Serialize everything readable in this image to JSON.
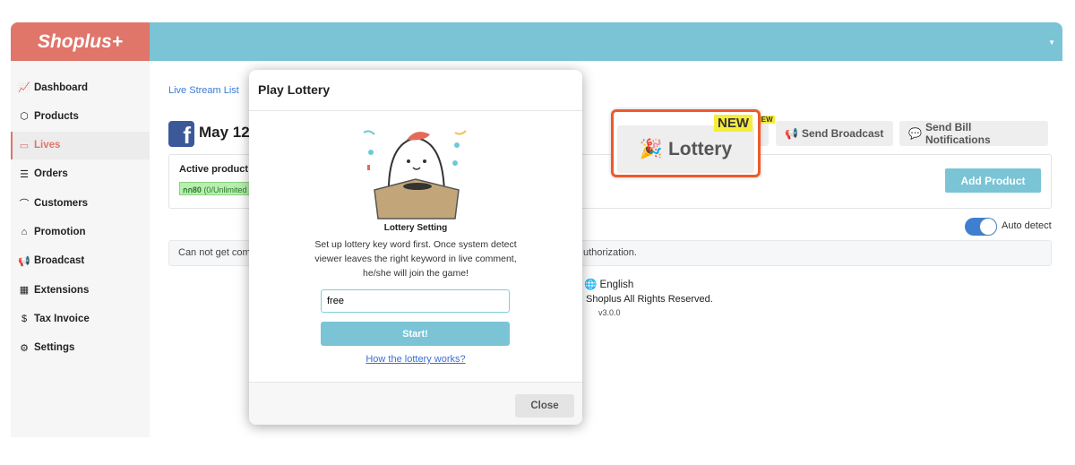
{
  "header": {
    "logo": "Shoplus+",
    "menu_icon": "caret-down-icon"
  },
  "sidebar": {
    "items": [
      {
        "label": "Dashboard",
        "icon": "chart-line-icon",
        "glyph": "📈"
      },
      {
        "label": "Products",
        "icon": "box-icon",
        "glyph": "⬡"
      },
      {
        "label": "Lives",
        "icon": "live-icon",
        "glyph": "▭",
        "active": true
      },
      {
        "label": "Orders",
        "icon": "list-icon",
        "glyph": "☰"
      },
      {
        "label": "Customers",
        "icon": "user-icon",
        "glyph": "⌒"
      },
      {
        "label": "Promotion",
        "icon": "tag-icon",
        "glyph": "⌂"
      },
      {
        "label": "Broadcast",
        "icon": "megaphone-icon",
        "glyph": "📢"
      },
      {
        "label": "Extensions",
        "icon": "grid-icon",
        "glyph": "▦"
      },
      {
        "label": "Tax Invoice",
        "icon": "dollar-circle-icon",
        "glyph": "$"
      },
      {
        "label": "Settings",
        "icon": "gear-icon",
        "glyph": "⚙"
      }
    ]
  },
  "main": {
    "breadcrumb": "Live Stream List",
    "title": "May 12,",
    "toolbar": {
      "partial_button": "y",
      "partial_badge": "NEW",
      "send_broadcast": "Send Broadcast",
      "send_bill": "Send Bill Notifications"
    },
    "active_products_label": "Active product",
    "product_chip": {
      "code": "กก80",
      "qty": "(0/Unlimited"
    },
    "add_product": "Add Product",
    "auto_detect": {
      "label": "Auto detect",
      "on": true
    },
    "alert": {
      "start": "Can not get com",
      "end": "uthorization."
    },
    "footer": {
      "language": "English",
      "rights": "Shoplus All Rights Reserved.",
      "version": "v3.0.0"
    }
  },
  "highlight": {
    "label": "Lottery",
    "badge": "NEW",
    "color": "#ee5a2a"
  },
  "modal": {
    "title": "Play Lottery",
    "subtitle": "Lottery Setting",
    "description": "Set up lottery key word first. Once system detect viewer leaves the right keyword in live comment, he/she will join the game!",
    "keyword_value": "free",
    "start": "Start!",
    "how_link": "How the lottery works?",
    "close": "Close"
  },
  "colors": {
    "brand": "#e0756a",
    "topbar": "#7ac4d6",
    "accent": "#7ac4d6",
    "toggle": "#3f7fd0"
  }
}
